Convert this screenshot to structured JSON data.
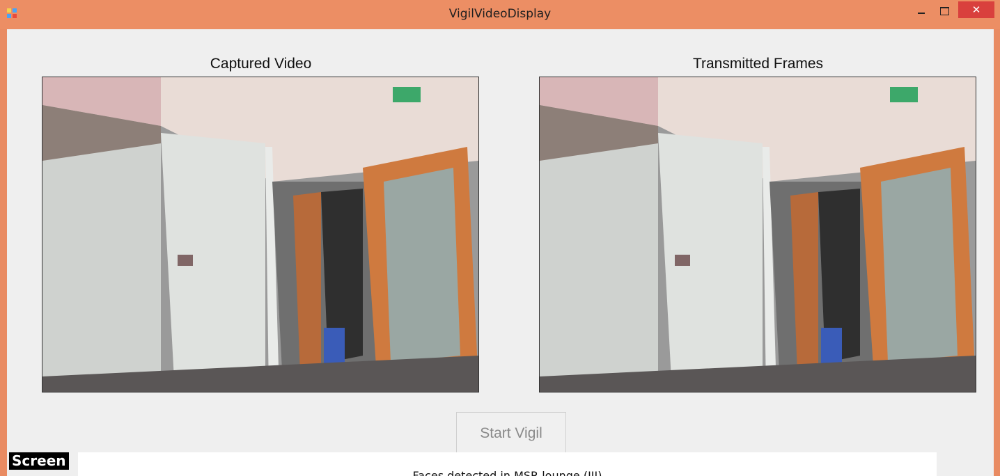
{
  "window": {
    "title": "VigilVideoDisplay",
    "close_glyph": "✕"
  },
  "panels": {
    "captured_label": "Captured Video",
    "transmitted_label": "Transmitted Frames"
  },
  "controls": {
    "start_label": "Start Vigil"
  },
  "overlay": {
    "badge": "Screen",
    "caption": "Faces detected in MSR lounge (III)"
  },
  "colors": {
    "titlebar": "#ec8e64",
    "close_button": "#d9403d",
    "client_background": "#efefef"
  },
  "icons": [
    "app-icon",
    "minimize-icon",
    "maximize-icon",
    "close-icon"
  ]
}
